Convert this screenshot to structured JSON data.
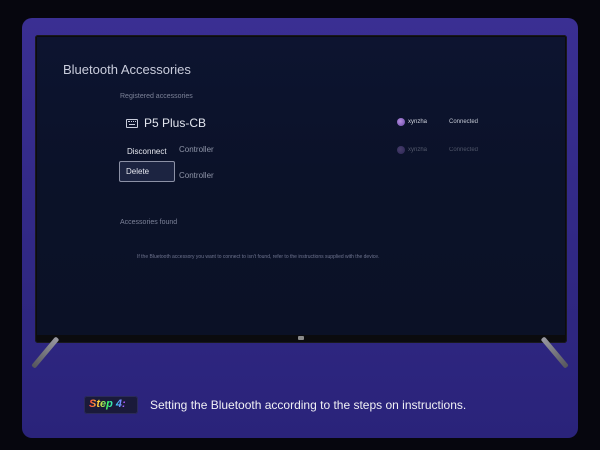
{
  "screen": {
    "title": "Bluetooth Accessories",
    "registered_label": "Registered accessories",
    "device": {
      "name": "P5 Plus-CB",
      "icon": "keyboard-icon",
      "user": "xynzha",
      "status": "Connected"
    },
    "secondary_device": {
      "label": "Controller",
      "user": "xynzha",
      "status": "Connected"
    },
    "third_label": "Controller",
    "context_menu": {
      "disconnect": "Disconnect",
      "delete": "Delete"
    },
    "found_label": "Accessories found",
    "found_note": "If the Bluetooth accessory you want to connect to isn't found, refer to the instructions supplied with the device."
  },
  "footer": {
    "step_badge": "Step 4:",
    "caption": "Setting the Bluetooth according to the steps on instructions."
  },
  "colors": {
    "panel": "#332a88",
    "screen": "#0c1229",
    "accent_user": "#8f6ad0"
  }
}
